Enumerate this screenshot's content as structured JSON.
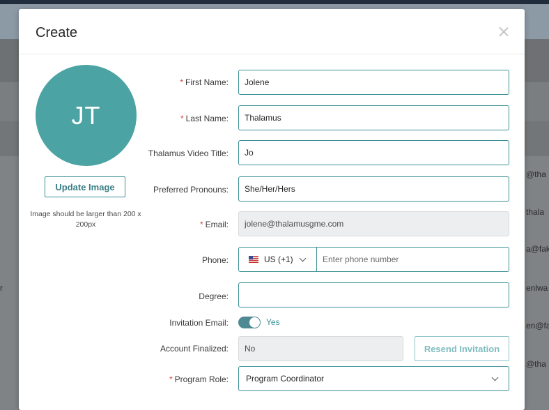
{
  "background": {
    "row_texts_right": [
      "@tha",
      "thala",
      "a@fak",
      "enlwa",
      "en@fa",
      "@tha"
    ],
    "row_text_left": "r"
  },
  "modal": {
    "title": "Create",
    "avatar_initials": "JT",
    "update_image_label": "Update Image",
    "image_hint": "Image should be larger than 200 x 200px",
    "fields": {
      "first_name": {
        "label": "First Name:",
        "value": "Jolene",
        "required": true
      },
      "last_name": {
        "label": "Last Name:",
        "value": "Thalamus",
        "required": true
      },
      "video_title": {
        "label": "Thalamus Video Title:",
        "value": "Jo"
      },
      "pronouns": {
        "label": "Preferred Pronouns:",
        "value": "She/Her/Hers"
      },
      "email": {
        "label": "Email:",
        "value": "jolene@thalamusgme.com",
        "required": true
      },
      "phone": {
        "label": "Phone:",
        "country": "US (+1)",
        "placeholder": "Enter phone number"
      },
      "degree": {
        "label": "Degree:",
        "value": ""
      },
      "invitation_email": {
        "label": "Invitation Email:",
        "value": "Yes"
      },
      "account_finalized": {
        "label": "Account Finalized:",
        "value": "No"
      },
      "program_role": {
        "label": "Program Role:",
        "value": "Program Coordinator",
        "required": true
      }
    },
    "resend_invitation_label": "Resend Invitation",
    "required_mark": "*"
  },
  "colors": {
    "accent": "#3a8f94",
    "avatar": "#4ba3a3",
    "required": "#e0453a"
  }
}
